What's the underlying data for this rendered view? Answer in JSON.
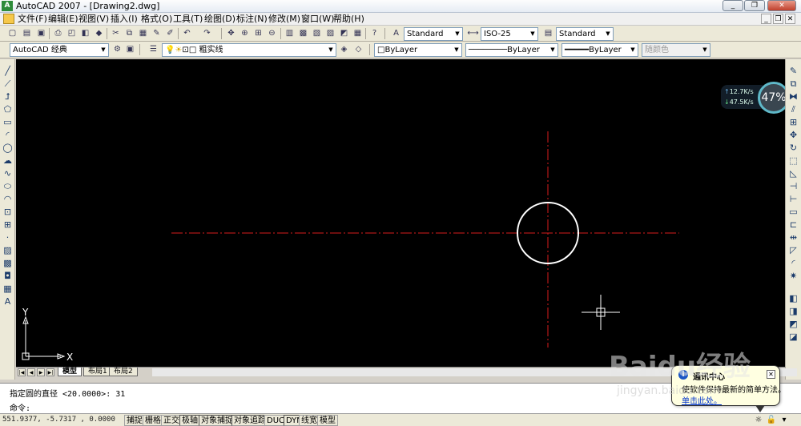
{
  "window": {
    "title": "AutoCAD 2007 - [Drawing2.dwg]",
    "minimize": "_",
    "restore": "❐",
    "close": "✕"
  },
  "menu": [
    "文件(F)",
    "编辑(E)",
    "视图(V)",
    "插入(I)",
    "格式(O)",
    "工具(T)",
    "绘图(D)",
    "标注(N)",
    "修改(M)",
    "窗口(W)",
    "帮助(H)"
  ],
  "toolbar": {
    "text_style": "Standard",
    "dim_style": "ISO-25",
    "table_style": "Standard",
    "workspace": "AutoCAD 经典",
    "layer": "粗实线",
    "color": "ByLayer",
    "linetype": "ByLayer",
    "lineweight": "ByLayer",
    "plot_style": "随颜色"
  },
  "net_monitor": {
    "upload": "12.7K/s",
    "download": "47.5K/s",
    "percent": "47%"
  },
  "ucs": {
    "x": "X",
    "y": "Y"
  },
  "layout_tabs": [
    {
      "label": "模型",
      "active": true
    },
    {
      "label": "布局1",
      "active": false
    },
    {
      "label": "布局2",
      "active": false
    }
  ],
  "command": {
    "history": "指定圆的直径 <20.0000>: 31",
    "prompt": "命令:"
  },
  "status": {
    "coords": "551.9377, -5.7317 , 0.0000",
    "buttons": [
      "捕捉",
      "栅格",
      "正交",
      "极轴",
      "对象捕捉",
      "对象追踪",
      "DUCS",
      "DYN",
      "线宽",
      "模型"
    ]
  },
  "balloon": {
    "title": "通讯中心",
    "message": "使软件保持最新的简单方法。",
    "link": "单击此处。"
  },
  "watermark": {
    "main": "Baidu经验",
    "sub": "jingyan.baidu.com"
  },
  "colors": {
    "canvas": "#000000",
    "centerline": "#d81c1c",
    "circle": "#ffffff",
    "chrome": "#ece9d8"
  }
}
